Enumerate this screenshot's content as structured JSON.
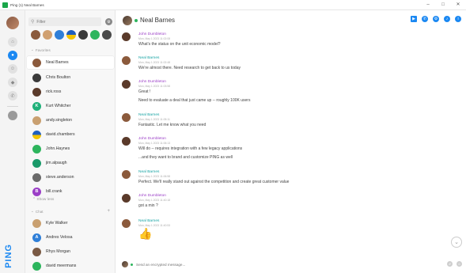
{
  "window": {
    "title": "Ping (1) Neal Barnes",
    "minimize": "–",
    "maximize": "□",
    "close": "✕"
  },
  "rail": {
    "brand": "PING",
    "icons": [
      "home-icon",
      "chat-icon",
      "group-icon",
      "bookmark-icon",
      "phone-icon",
      "user-icon"
    ]
  },
  "contacts": {
    "filter_placeholder": "Filter",
    "favorites_label": "Favorites",
    "favorites": [
      {
        "name": "Neal Barnes",
        "selected": true
      },
      {
        "name": "Chris Boulton"
      },
      {
        "name": "rick.ross"
      },
      {
        "name": "Kurt Whitcher",
        "initial": "K"
      },
      {
        "name": "andy.singleton"
      },
      {
        "name": "david.chambers"
      },
      {
        "name": "John.Haynes"
      },
      {
        "name": "jim.alpaugh"
      },
      {
        "name": "steve.anderson"
      },
      {
        "name": "bill.crank",
        "initial": "B"
      }
    ],
    "show_less": "Show less",
    "chat_label": "Chat",
    "chat_add": "+",
    "chats": [
      {
        "name": "Kyle Walker"
      },
      {
        "name": "Andres Velosa",
        "initial": "A"
      },
      {
        "name": "Rhys Morgan"
      },
      {
        "name": "david meermans"
      }
    ]
  },
  "header": {
    "name": "Neal Barnes"
  },
  "messages": [
    {
      "sender": "John Dumbleton",
      "time": "Mon, May 1 2023 11:02:08",
      "lines": [
        "What's the status on the unit economic model?"
      ]
    },
    {
      "sender": "Neal Barnes",
      "time": "Mon, May 1 2023 11:02:48",
      "lines": [
        "We're almost there.  Need research to get back to us today"
      ]
    },
    {
      "sender": "John Dumbleton",
      "time": "Mon, May 1 2023 11:03:58",
      "lines": [
        "Great !",
        "Need to evaluate a deal that just came up -- roughly 100K users"
      ]
    },
    {
      "sender": "Neal Barnes",
      "time": "Mon, May 1 2023 11:05:11",
      "lines": [
        "Fantastic.  Let me know what you need"
      ]
    },
    {
      "sender": "John Dumbleton",
      "time": "Mon, May 1 2023 11:06:13",
      "lines": [
        "Will do -- requires integration with a few legacy applications",
        "...and they want to brand and customize PING as well"
      ]
    },
    {
      "sender": "Neal Barnes",
      "time": "Mon, May 1 2023 11:06:58",
      "lines": [
        "Perfect.  We'll really stand out against the competition and create great customer value"
      ]
    },
    {
      "sender": "John Dumbleton",
      "time": "Mon, May 1 2023 11:40:18",
      "lines": [
        "got a min ?"
      ]
    },
    {
      "sender": "Neal Barnes",
      "time": "Mon, May 1 2023 11:40:53",
      "emoji": "👍"
    }
  ],
  "composer": {
    "placeholder": "Send an encrypted message..."
  }
}
